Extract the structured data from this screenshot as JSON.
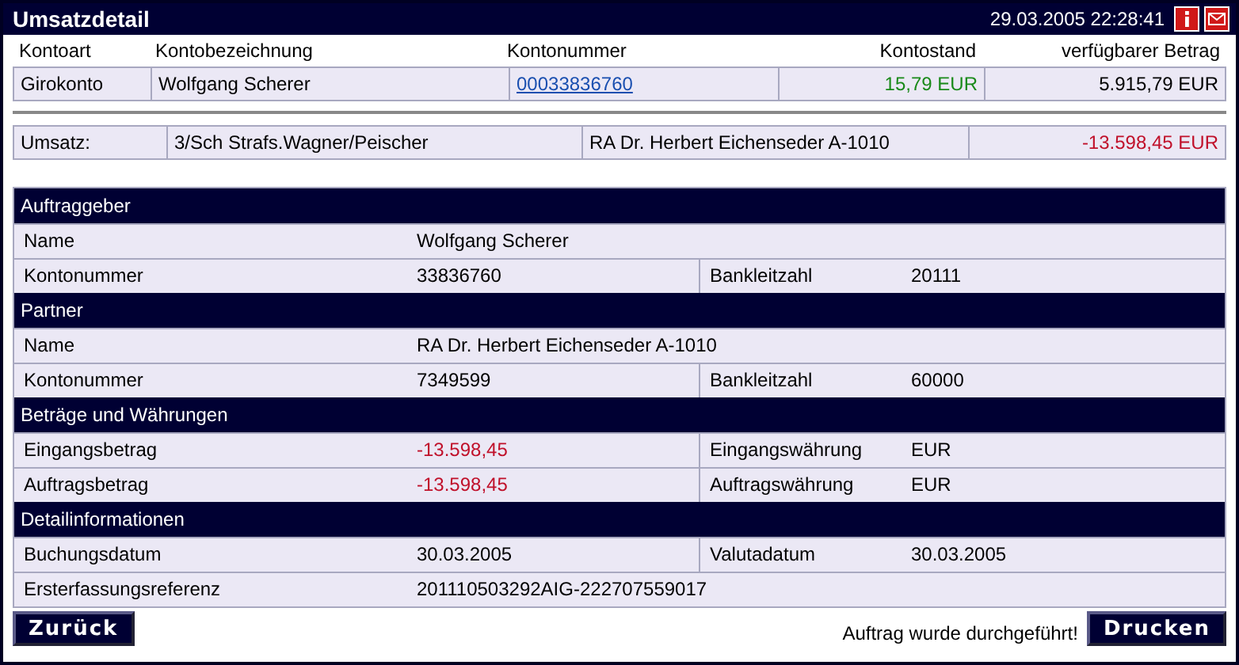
{
  "window": {
    "title": "Umsatzdetail",
    "datetime": "29.03.2005 22:28:41",
    "icons": [
      {
        "kind": "info"
      },
      {
        "kind": "mail"
      }
    ]
  },
  "account": {
    "columns": [
      "Kontoart",
      "Kontobezeichnung",
      "Kontonummer",
      "Kontostand",
      "verfügbarer Betrag"
    ],
    "row": [
      {
        "text": "Girokonto",
        "kind": "text"
      },
      {
        "text": "Wolfgang Scherer",
        "kind": "text"
      },
      {
        "text": "00033836760",
        "kind": "link"
      },
      {
        "text": "15,79 EUR",
        "kind": "positive"
      },
      {
        "text": "5.915,79 EUR",
        "kind": "text"
      }
    ]
  },
  "transaction": {
    "label": "Umsatz:",
    "text": "3/Sch Strafs.Wagner/Peischer",
    "partner": "RA Dr. Herbert Eichenseder A-1010",
    "amount": "-13.598,45 EUR",
    "kind": "negative"
  },
  "sections": [
    {
      "title": "Auftraggeber",
      "rows": [
        {
          "label": "Name",
          "value": "Wolfgang Scherer"
        },
        {
          "label": "Kontonummer",
          "value": "33836760",
          "label2": "Bankleitzahl",
          "value2": "20111"
        }
      ]
    },
    {
      "title": "Partner",
      "rows": [
        {
          "label": "Name",
          "value": "RA Dr. Herbert Eichenseder A-1010"
        },
        {
          "label": "Kontonummer",
          "value": "7349599",
          "label2": "Bankleitzahl",
          "value2": "60000"
        }
      ]
    },
    {
      "title": "Beträge und Währungen",
      "rows": [
        {
          "label": "Eingangsbetrag",
          "value": "-13.598,45",
          "kind": "negative",
          "label2": "Eingangswährung",
          "value2": "EUR"
        },
        {
          "label": "Auftragsbetrag",
          "value": "-13.598,45",
          "kind": "negative",
          "label2": "Auftragswährung",
          "value2": "EUR"
        }
      ]
    },
    {
      "title": "Detailinformationen",
      "rows": [
        {
          "label": "Buchungsdatum",
          "value": "30.03.2005",
          "label2": "Valutadatum",
          "value2": "30.03.2005"
        },
        {
          "label": "Ersterfassungsreferenz",
          "value": "201110503292AIG-222707559017"
        }
      ]
    }
  ],
  "footer": {
    "back_button": "Zurück",
    "status": "Auftrag wurde durchgeführt!",
    "print_button": "Drucken"
  }
}
